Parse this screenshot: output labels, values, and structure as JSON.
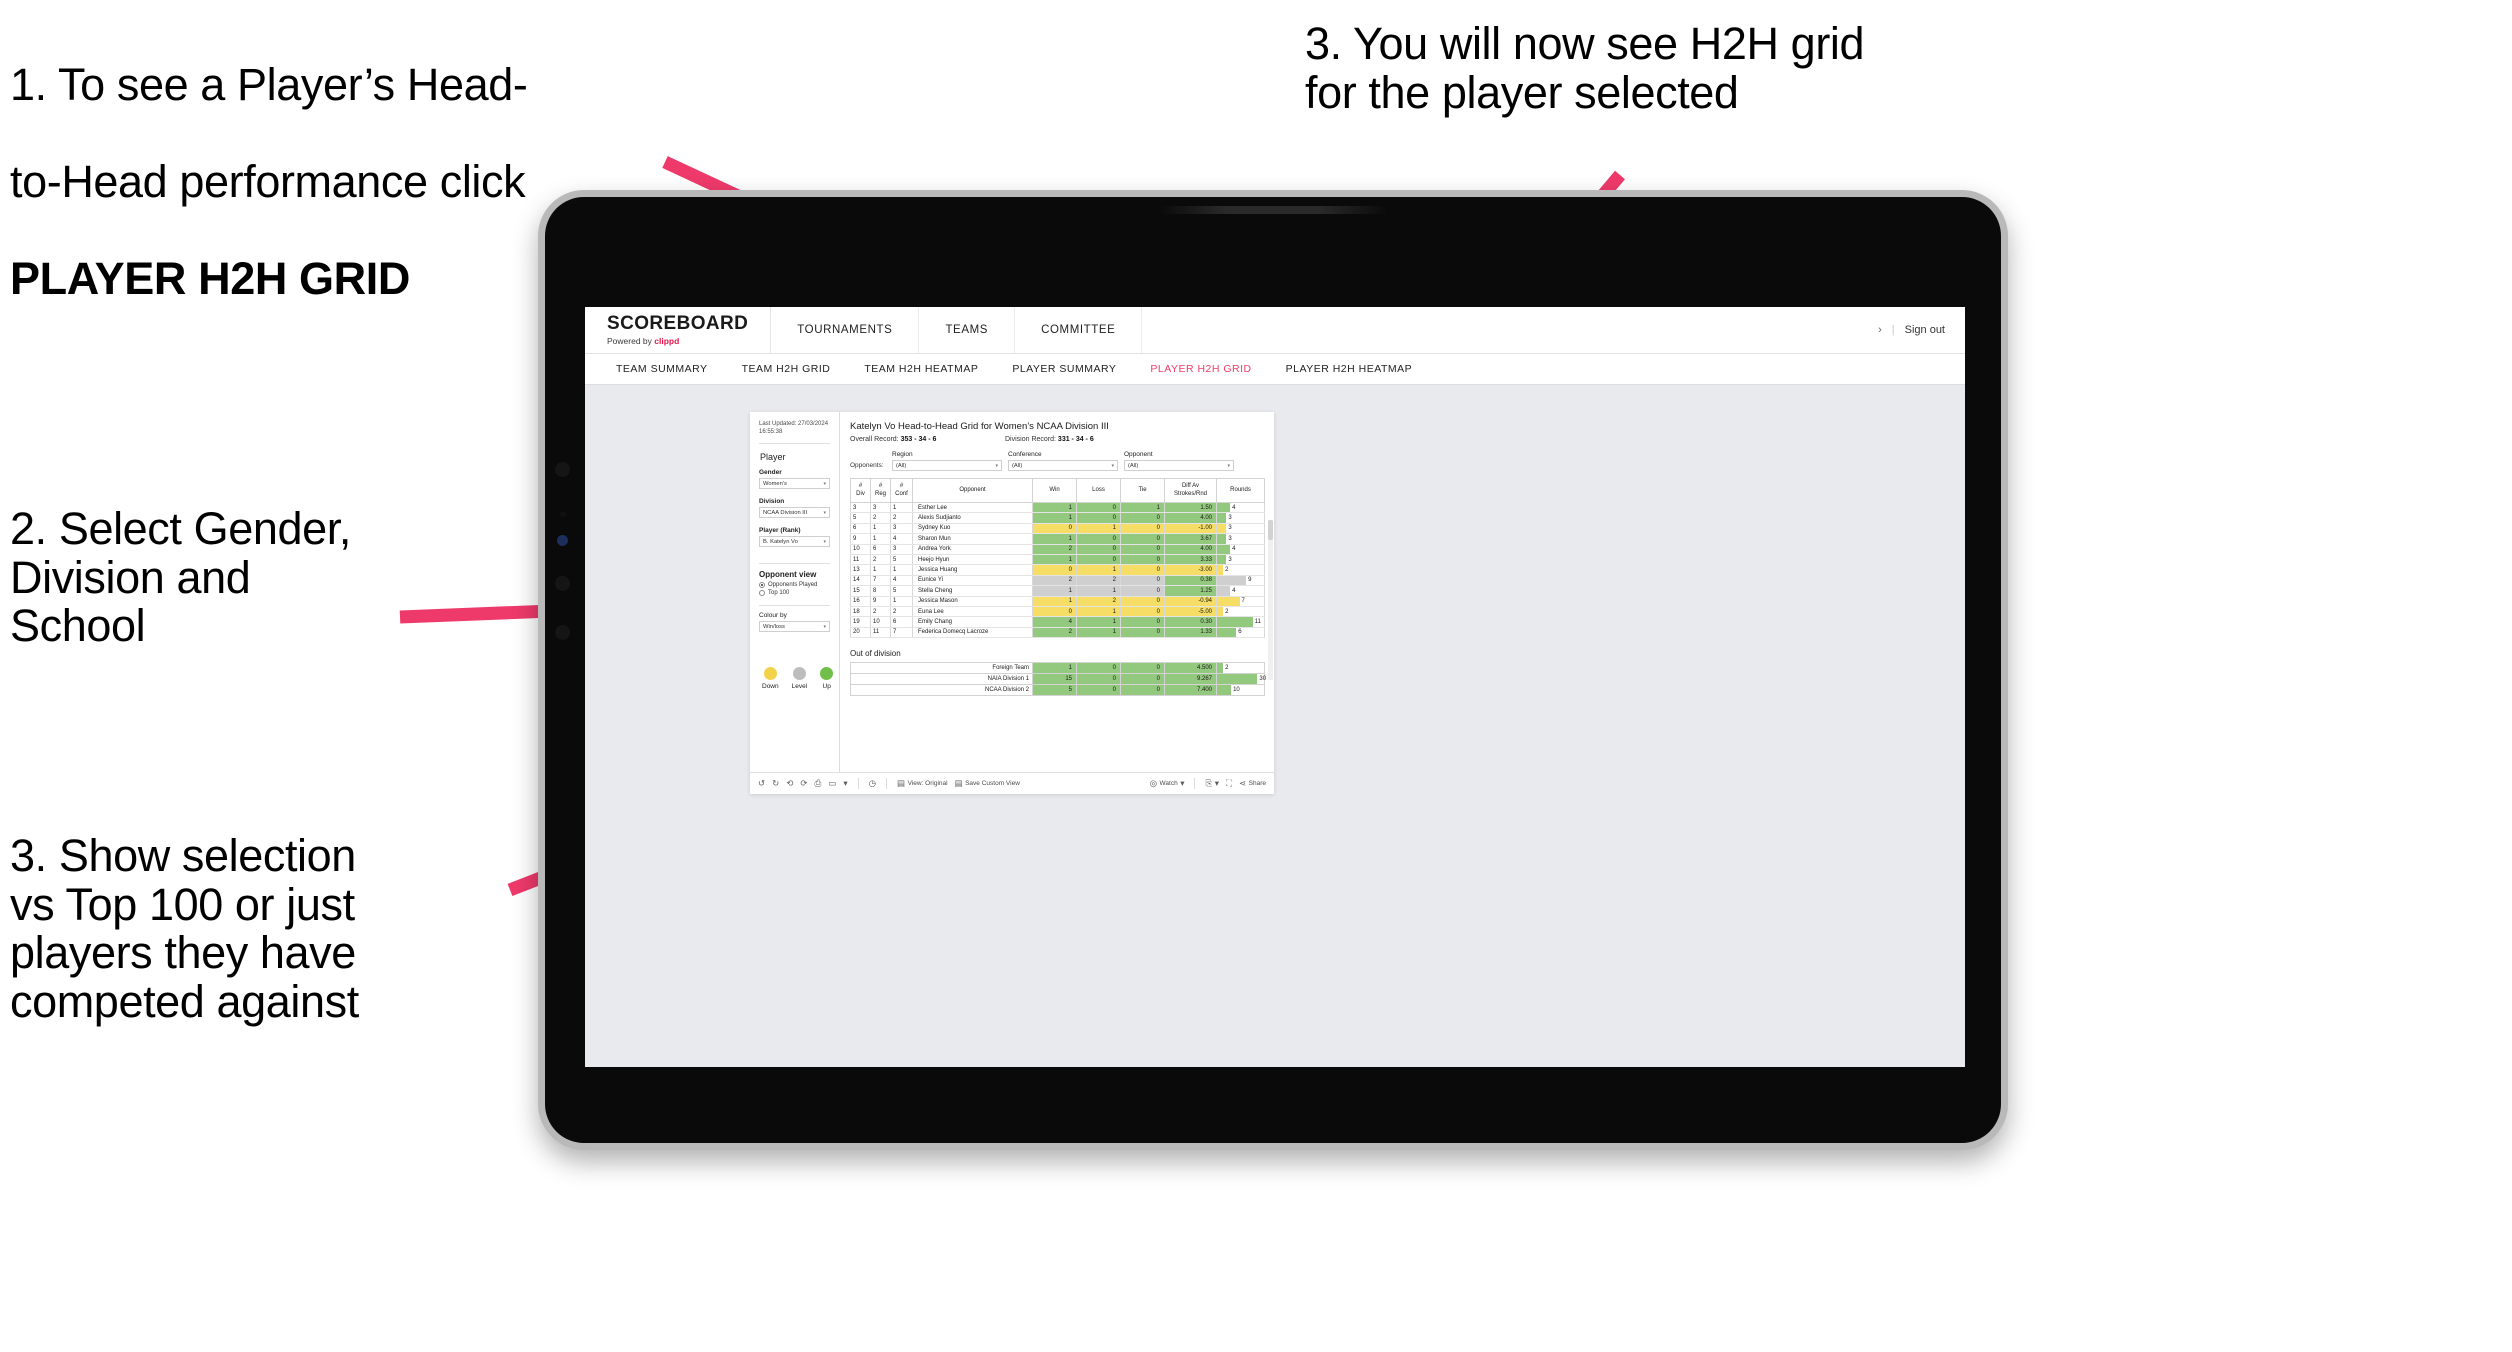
{
  "annotations": [
    {
      "id": "anno-1",
      "lines": [
        "1. To see a Player’s Head-",
        "to-Head performance click"
      ],
      "bold_line": "PLAYER H2H GRID"
    },
    {
      "id": "anno-2",
      "text": "2. Select Gender,\nDivision and\nSchool"
    },
    {
      "id": "anno-3",
      "text": "3. Show selection\nvs Top 100 or just\nplayers they have\ncompeted against"
    },
    {
      "id": "anno-4",
      "text": "3. You will now see H2H grid\nfor the player selected"
    }
  ],
  "colors": {
    "accent_pink": "#ef3e68",
    "arrow_pink": "#ee3a6b",
    "brand_red": "#e8174a",
    "win_green": "#93c97e",
    "loss_yellow": "#f5dd66",
    "tie_grey": "#cfcfcf"
  },
  "app": {
    "brand": {
      "logo": "SCOREBOARD",
      "powered_prefix": "Powered by ",
      "powered_brand": "clippd"
    },
    "top_nav": [
      "TOURNAMENTS",
      "TEAMS",
      "COMMITTEE"
    ],
    "account": {
      "chevron": "›",
      "separator": "|",
      "sign_out": "Sign out"
    },
    "sub_nav": [
      {
        "label": "TEAM SUMMARY",
        "active": false
      },
      {
        "label": "TEAM H2H GRID",
        "active": false
      },
      {
        "label": "TEAM H2H HEATMAP",
        "active": false
      },
      {
        "label": "PLAYER SUMMARY",
        "active": false
      },
      {
        "label": "PLAYER H2H GRID",
        "active": true
      },
      {
        "label": "PLAYER H2H HEATMAP",
        "active": false
      }
    ]
  },
  "viz": {
    "last_updated": "Last Updated: 27/03/2024 16:55:38",
    "sidebar": {
      "player_heading": "Player",
      "filters": [
        {
          "label": "Gender",
          "value": "Women's"
        },
        {
          "label": "Division",
          "value": "NCAA Division III"
        },
        {
          "label": "Player (Rank)",
          "value": "B. Katelyn Vo"
        }
      ],
      "opponent_view_heading": "Opponent view",
      "opponent_view_options": [
        {
          "label": "Opponents Played",
          "selected": true
        },
        {
          "label": "Top 100",
          "selected": false
        }
      ],
      "colour_by_label": "Colour by",
      "colour_by_value": "Win/loss",
      "legend": [
        {
          "label": "Down",
          "color": "#f2d24b"
        },
        {
          "label": "Level",
          "color": "#bdbdbd"
        },
        {
          "label": "Up",
          "color": "#6fbf4a"
        }
      ]
    },
    "title": "Katelyn Vo Head-to-Head Grid for Women’s NCAA Division III",
    "overall_record_label": "Overall Record:",
    "overall_record_value": "353 -  34 - 6",
    "division_record_label": "Division Record:",
    "division_record_value": "331 -  34 - 6",
    "opponents_label": "Opponents:",
    "opponent_filters": [
      {
        "heading": "Region",
        "value": "(All)"
      },
      {
        "heading": "Conference",
        "value": "(All)"
      },
      {
        "heading": "Opponent",
        "value": "(All)"
      }
    ],
    "out_of_division_heading": "Out of division",
    "toolbar": {
      "view_label": "View: Original",
      "save_label": "Save Custom View",
      "watch_label": "Watch",
      "share_label": "Share"
    }
  },
  "chart_data": {
    "type": "table",
    "title": "Katelyn Vo Head-to-Head Grid for Women’s NCAA Division III",
    "columns": [
      "# Div",
      "# Reg",
      "# Conf",
      "Opponent",
      "Win",
      "Loss",
      "Tie",
      "Diff Av Strokes/Rnd",
      "Rounds"
    ],
    "column_headers_multiline": [
      [
        "#",
        "Div"
      ],
      [
        "#",
        "Reg"
      ],
      [
        "#",
        "Conf"
      ],
      [
        "Opponent"
      ],
      [
        "Win"
      ],
      [
        "Loss"
      ],
      [
        "Tie"
      ],
      [
        "Diff Av",
        "Strokes/Rnd"
      ],
      [
        "Rounds"
      ]
    ],
    "rows": [
      {
        "div": "3",
        "reg": "3",
        "conf": "1",
        "opponent": "Esther Lee",
        "win": "1",
        "loss": "0",
        "tie": "1",
        "diff": "1.50",
        "rounds": "4",
        "rounds_pct": 28,
        "state": "up"
      },
      {
        "div": "5",
        "reg": "2",
        "conf": "2",
        "opponent": "Alexis Sudjianto",
        "win": "1",
        "loss": "0",
        "tie": "0",
        "diff": "4.00",
        "rounds": "3",
        "rounds_pct": 20,
        "state": "up"
      },
      {
        "div": "6",
        "reg": "1",
        "conf": "3",
        "opponent": "Sydney Kuo",
        "win": "0",
        "loss": "1",
        "tie": "0",
        "diff": "-1.00",
        "rounds": "3",
        "rounds_pct": 20,
        "state": "down"
      },
      {
        "div": "9",
        "reg": "1",
        "conf": "4",
        "opponent": "Sharon Mun",
        "win": "1",
        "loss": "0",
        "tie": "0",
        "diff": "3.67",
        "rounds": "3",
        "rounds_pct": 20,
        "state": "up"
      },
      {
        "div": "10",
        "reg": "6",
        "conf": "3",
        "opponent": "Andrea York",
        "win": "2",
        "loss": "0",
        "tie": "0",
        "diff": "4.00",
        "rounds": "4",
        "rounds_pct": 28,
        "state": "up"
      },
      {
        "div": "11",
        "reg": "2",
        "conf": "5",
        "opponent": "Heejo Hyun",
        "win": "1",
        "loss": "0",
        "tie": "0",
        "diff": "3.33",
        "rounds": "3",
        "rounds_pct": 20,
        "state": "up"
      },
      {
        "div": "13",
        "reg": "1",
        "conf": "1",
        "opponent": "Jessica Huang",
        "win": "0",
        "loss": "1",
        "tie": "0",
        "diff": "-3.00",
        "rounds": "2",
        "rounds_pct": 13,
        "state": "down"
      },
      {
        "div": "14",
        "reg": "7",
        "conf": "4",
        "opponent": "Eunice Yi",
        "win": "2",
        "loss": "2",
        "tie": "0",
        "diff": "0.38",
        "rounds": "9",
        "rounds_pct": 62,
        "state": "level"
      },
      {
        "div": "15",
        "reg": "8",
        "conf": "5",
        "opponent": "Stella Cheng",
        "win": "1",
        "loss": "1",
        "tie": "0",
        "diff": "1.25",
        "rounds": "4",
        "rounds_pct": 28,
        "state": "level"
      },
      {
        "div": "16",
        "reg": "9",
        "conf": "1",
        "opponent": "Jessica Mason",
        "win": "1",
        "loss": "2",
        "tie": "0",
        "diff": "-0.94",
        "rounds": "7",
        "rounds_pct": 48,
        "state": "down"
      },
      {
        "div": "18",
        "reg": "2",
        "conf": "2",
        "opponent": "Euna Lee",
        "win": "0",
        "loss": "1",
        "tie": "0",
        "diff": "-5.00",
        "rounds": "2",
        "rounds_pct": 13,
        "state": "down"
      },
      {
        "div": "19",
        "reg": "10",
        "conf": "6",
        "opponent": "Emily Chang",
        "win": "4",
        "loss": "1",
        "tie": "0",
        "diff": "0.30",
        "rounds": "11",
        "rounds_pct": 76,
        "state": "up"
      },
      {
        "div": "20",
        "reg": "11",
        "conf": "7",
        "opponent": "Federica Domecq Lacroze",
        "win": "2",
        "loss": "1",
        "tie": "0",
        "diff": "1.33",
        "rounds": "6",
        "rounds_pct": 41,
        "state": "up"
      }
    ],
    "out_of_division": {
      "heading": "Out of division",
      "rows": [
        {
          "name": "Foreign Team",
          "win": "1",
          "loss": "0",
          "tie": "0",
          "diff": "4.500",
          "rounds": "2",
          "rounds_pct": 13,
          "state": "up"
        },
        {
          "name": "NAIA Division 1",
          "win": "15",
          "loss": "0",
          "tie": "0",
          "diff": "9.267",
          "rounds": "30",
          "rounds_pct": 86,
          "state": "up"
        },
        {
          "name": "NCAA Division 2",
          "win": "5",
          "loss": "0",
          "tie": "0",
          "diff": "7.400",
          "rounds": "10",
          "rounds_pct": 30,
          "state": "up"
        }
      ]
    }
  }
}
